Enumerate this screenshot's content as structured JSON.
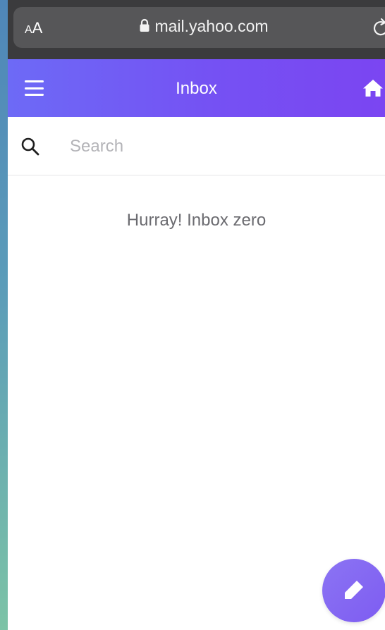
{
  "browser": {
    "text_size_small": "A",
    "text_size_large": "A",
    "url": "mail.yahoo.com",
    "icons": {
      "lock": "lock-icon",
      "reload": "reload-icon"
    }
  },
  "header": {
    "title": "Inbox",
    "icons": {
      "menu": "hamburger-menu-icon",
      "home": "home-icon"
    }
  },
  "search": {
    "placeholder": "Search",
    "value": "",
    "icon": "search-icon"
  },
  "inbox": {
    "empty_message": "Hurray! Inbox zero"
  },
  "compose": {
    "icon": "pencil-icon"
  },
  "colors": {
    "header_start": "#6d6af6",
    "header_end": "#7b45f2",
    "fab": "#8b74f3",
    "chrome": "#3b3b3d"
  }
}
